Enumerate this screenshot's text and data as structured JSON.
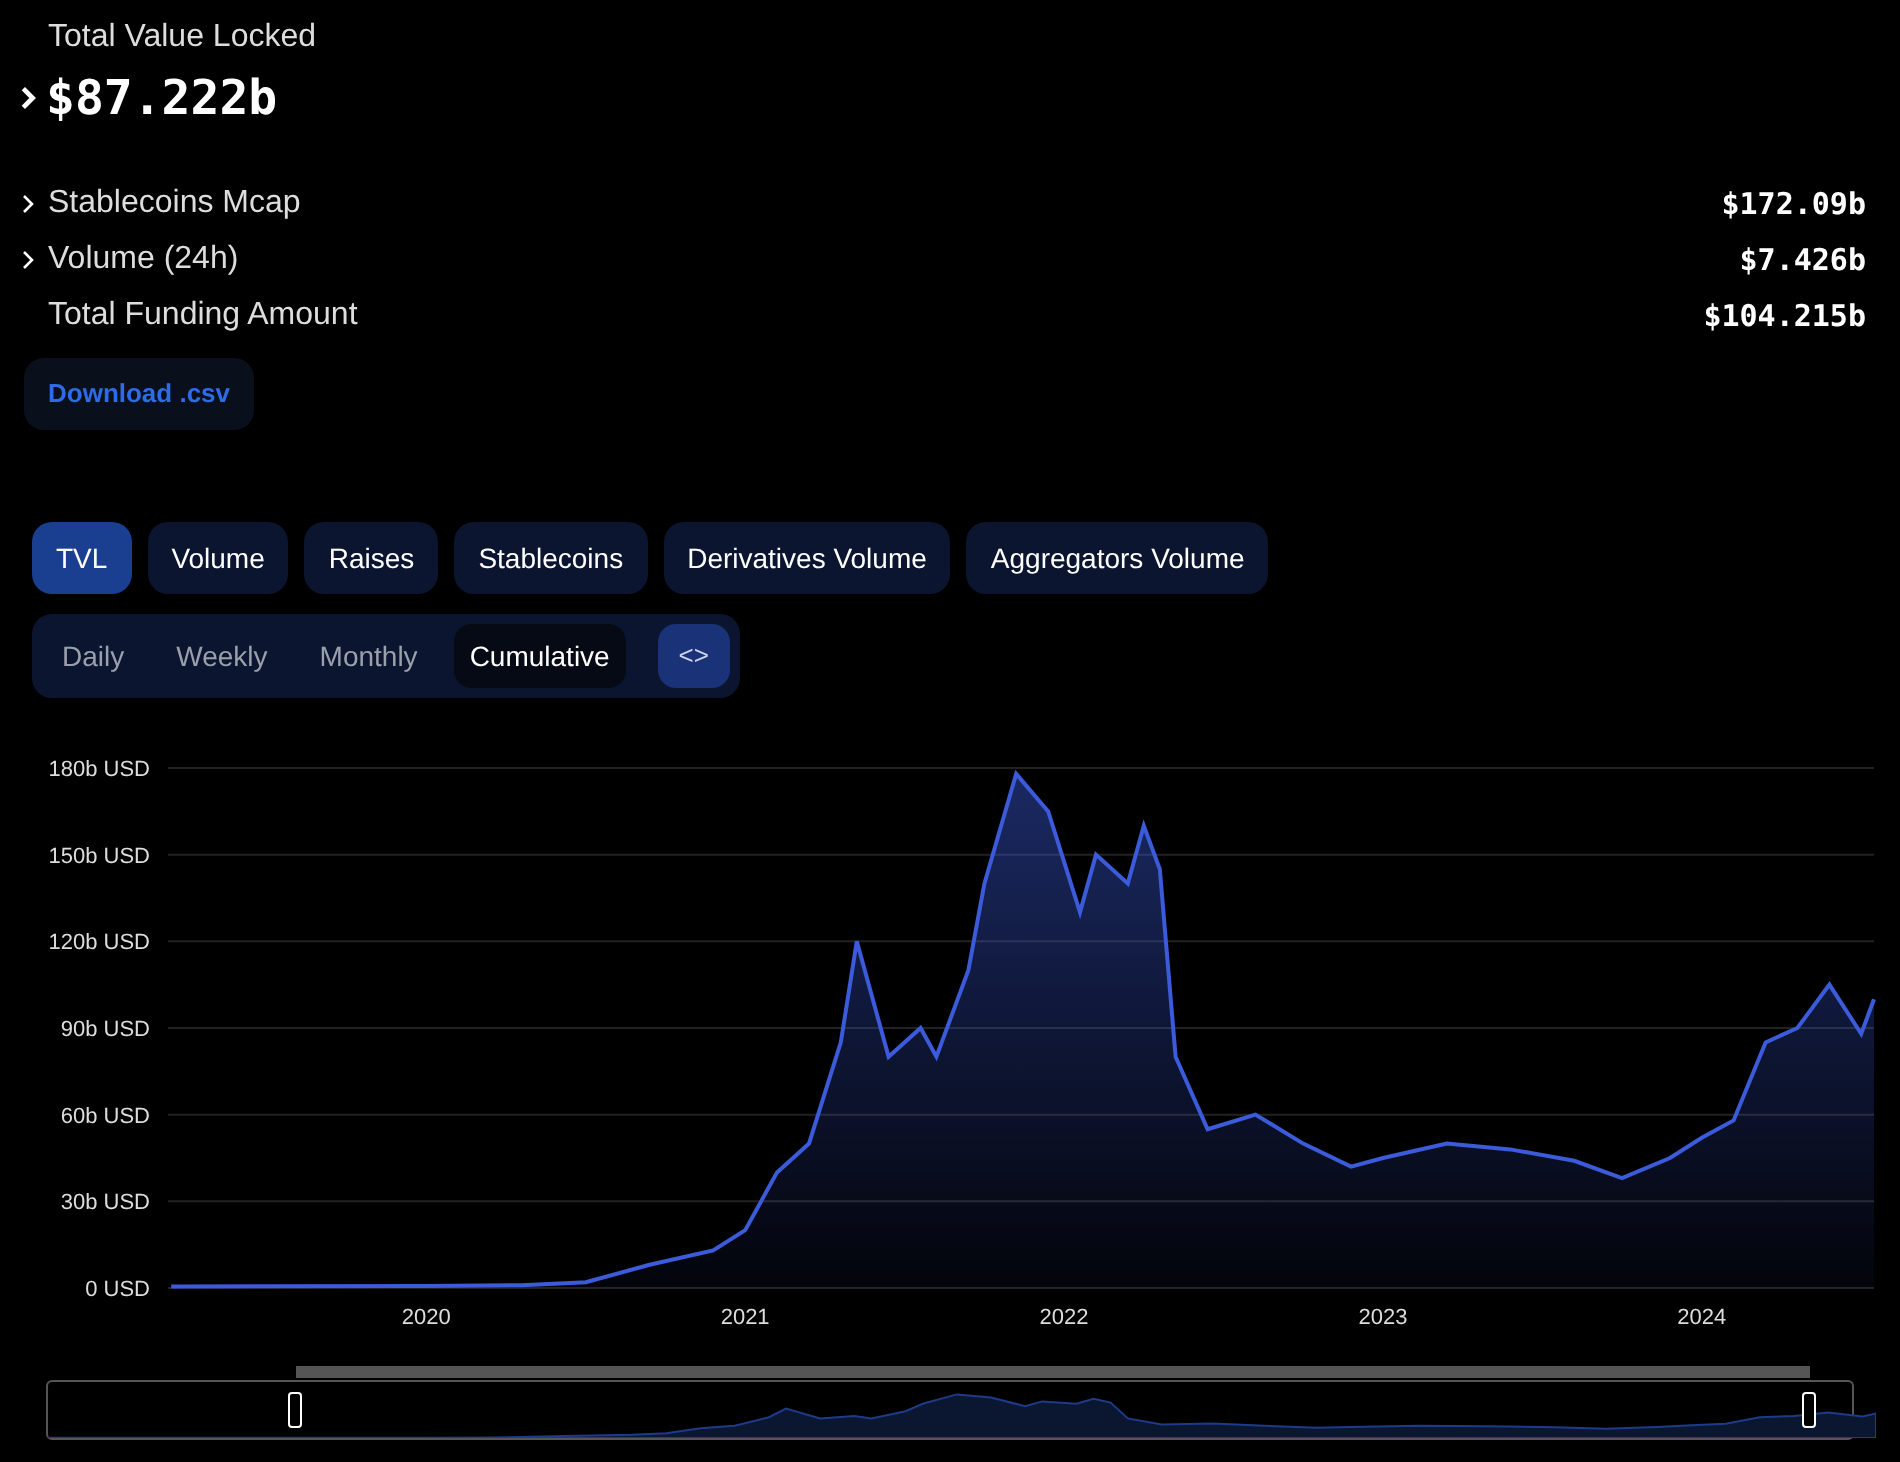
{
  "tvl": {
    "label": "Total Value Locked",
    "value": "$87.222b",
    "expandable": true
  },
  "metrics": [
    {
      "label": "Stablecoins Mcap",
      "value": "$172.09b",
      "expandable": true
    },
    {
      "label": "Volume (24h)",
      "value": "$7.426b",
      "expandable": true
    },
    {
      "label": "Total Funding Amount",
      "value": "$104.215b",
      "expandable": false
    }
  ],
  "download": "Download .csv",
  "tabs": [
    {
      "label": "TVL",
      "selected": true
    },
    {
      "label": "Volume",
      "selected": false
    },
    {
      "label": "Raises",
      "selected": false
    },
    {
      "label": "Stablecoins",
      "selected": false
    },
    {
      "label": "Derivatives Volume",
      "selected": false
    },
    {
      "label": "Aggregators Volume",
      "selected": false
    }
  ],
  "periods": [
    {
      "label": "Daily",
      "selected": false
    },
    {
      "label": "Weekly",
      "selected": false
    },
    {
      "label": "Monthly",
      "selected": false
    },
    {
      "label": "Cumulative",
      "selected": true
    }
  ],
  "embed": "<>",
  "brush": {
    "start": {
      "level": 0.135
    },
    "end": {
      "level": 0.963
    }
  },
  "chart_data": {
    "type": "area",
    "x": [
      2019.2,
      2019.5,
      2020.0,
      2020.3,
      2020.5,
      2020.7,
      2020.9,
      2021.0,
      2021.1,
      2021.2,
      2021.3,
      2021.35,
      2021.45,
      2021.55,
      2021.6,
      2021.7,
      2021.75,
      2021.85,
      2021.95,
      2022.05,
      2022.1,
      2022.2,
      2022.25,
      2022.3,
      2022.35,
      2022.45,
      2022.6,
      2022.75,
      2022.9,
      2023.0,
      2023.2,
      2023.4,
      2023.6,
      2023.75,
      2023.9,
      2024.0,
      2024.1,
      2024.2,
      2024.3,
      2024.4,
      2024.5,
      2024.54
    ],
    "grid": true,
    "series": [
      {
        "color": "#3b5bdb",
        "values": [
          0.5,
          0.6,
          0.7,
          1,
          2,
          8,
          13,
          20,
          40,
          50,
          85,
          120,
          80,
          90,
          80,
          110,
          140,
          178,
          165,
          130,
          150,
          140,
          160,
          145,
          80,
          55,
          60,
          50,
          42,
          45,
          50,
          48,
          44,
          38,
          45,
          52,
          58,
          85,
          90,
          105,
          88,
          100
        ]
      }
    ],
    "xlim": [
      2019.19,
      2024.54
    ],
    "ylim": [
      0,
      180
    ],
    "xticks": [
      {
        "value": 2020,
        "label": "2020"
      },
      {
        "value": 2021,
        "label": "2021"
      },
      {
        "value": 2022,
        "label": "2022"
      },
      {
        "value": 2023,
        "label": "2023"
      },
      {
        "value": 2024,
        "label": "2024"
      }
    ],
    "yticks": [
      {
        "value": 0,
        "label": "0 USD"
      },
      {
        "value": 30,
        "label": "30b USD"
      },
      {
        "value": 60,
        "label": "60b USD"
      },
      {
        "value": 90,
        "label": "90b USD"
      },
      {
        "value": 120,
        "label": "120b USD"
      },
      {
        "value": 150,
        "label": "150b USD"
      },
      {
        "value": 180,
        "label": "180b USD"
      }
    ]
  }
}
